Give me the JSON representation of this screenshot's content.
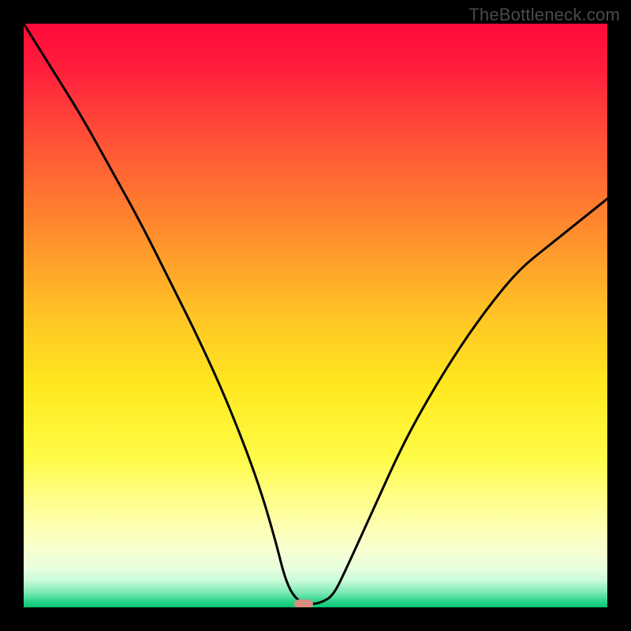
{
  "watermark": "TheBottleneck.com",
  "chart_data": {
    "type": "line",
    "title": "",
    "xlabel": "",
    "ylabel": "",
    "xlim": [
      0,
      100
    ],
    "ylim": [
      0,
      100
    ],
    "series": [
      {
        "name": "bottleneck-curve",
        "x": [
          0,
          5,
          10,
          15,
          20,
          25,
          30,
          35,
          40,
          43,
          45,
          47,
          49,
          51,
          53,
          55,
          60,
          65,
          70,
          75,
          80,
          85,
          90,
          95,
          100
        ],
        "values": [
          100,
          92,
          84,
          75,
          66,
          56,
          46,
          35,
          22,
          12,
          4,
          1,
          0.5,
          0.8,
          2,
          6,
          17,
          28,
          37,
          45,
          52,
          58,
          62,
          66,
          70
        ]
      }
    ],
    "marker": {
      "x": 48,
      "y": 0.5
    },
    "gradient_stops": [
      {
        "offset": 0.0,
        "color": "#ff0a3a"
      },
      {
        "offset": 0.08,
        "color": "#ff1f3d"
      },
      {
        "offset": 0.2,
        "color": "#ff5236"
      },
      {
        "offset": 0.35,
        "color": "#ff8a2d"
      },
      {
        "offset": 0.5,
        "color": "#ffc425"
      },
      {
        "offset": 0.62,
        "color": "#ffe81f"
      },
      {
        "offset": 0.74,
        "color": "#fffb45"
      },
      {
        "offset": 0.84,
        "color": "#ffffa0"
      },
      {
        "offset": 0.9,
        "color": "#f8ffd0"
      },
      {
        "offset": 0.935,
        "color": "#e6ffde"
      },
      {
        "offset": 0.955,
        "color": "#c7fbd8"
      },
      {
        "offset": 0.975,
        "color": "#7ae9b3"
      },
      {
        "offset": 0.99,
        "color": "#2ad489"
      },
      {
        "offset": 1.0,
        "color": "#08c772"
      }
    ]
  }
}
